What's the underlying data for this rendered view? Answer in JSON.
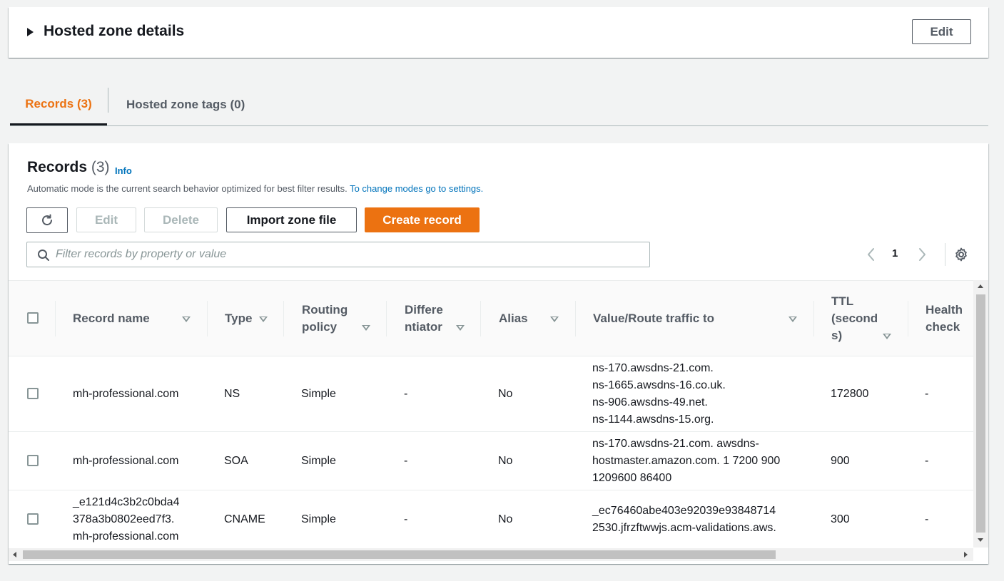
{
  "details": {
    "title": "Hosted zone details",
    "edit_label": "Edit"
  },
  "tabs": [
    {
      "label": "Records (3)",
      "active": true
    },
    {
      "label": "Hosted zone tags (0)",
      "active": false
    }
  ],
  "records": {
    "title": "Records",
    "count": "(3)",
    "info_label": "Info",
    "description": "Automatic mode is the current search behavior optimized for best filter results.",
    "description_link": "To change modes go to settings.",
    "toolbar": {
      "refresh_icon": "refresh-icon",
      "edit_label": "Edit",
      "delete_label": "Delete",
      "import_label": "Import zone file",
      "create_label": "Create record"
    },
    "search": {
      "placeholder": "Filter records by property or value",
      "value": ""
    },
    "pagination": {
      "current_page": "1"
    },
    "columns": [
      {
        "label": "Record name"
      },
      {
        "label": "Type"
      },
      {
        "label": "Routing policy"
      },
      {
        "label": "Differe ntiator"
      },
      {
        "label": "Alias"
      },
      {
        "label": "Value/Route traffic to"
      },
      {
        "label": "TTL (second s)"
      },
      {
        "label": "Health check"
      }
    ],
    "rows": [
      {
        "name": "mh-professional.com",
        "type": "NS",
        "routing": "Simple",
        "differentiator": "-",
        "alias": "No",
        "value": "ns-170.awsdns-21.com.\nns-1665.awsdns-16.co.uk.\nns-906.awsdns-49.net.\nns-1144.awsdns-15.org.",
        "ttl": "172800",
        "health": "-"
      },
      {
        "name": "mh-professional.com",
        "type": "SOA",
        "routing": "Simple",
        "differentiator": "-",
        "alias": "No",
        "value": "ns-170.awsdns-21.com. awsdns-\nhostmaster.amazon.com. 1 7200 900\n1209600 86400",
        "ttl": "900",
        "health": "-"
      },
      {
        "name": "_e121d4c3b2c0bda4\n378a3b0802eed7f3.\nmh-professional.com",
        "type": "CNAME",
        "routing": "Simple",
        "differentiator": "-",
        "alias": "No",
        "value": "_ec76460abe403e92039e93848714\n2530.jfrzftwwjs.acm-validations.aws.",
        "ttl": "300",
        "health": "-"
      }
    ]
  },
  "colors": {
    "accent": "#ec7211",
    "link": "#0073bb",
    "text": "#16191f",
    "muted": "#545b64"
  }
}
